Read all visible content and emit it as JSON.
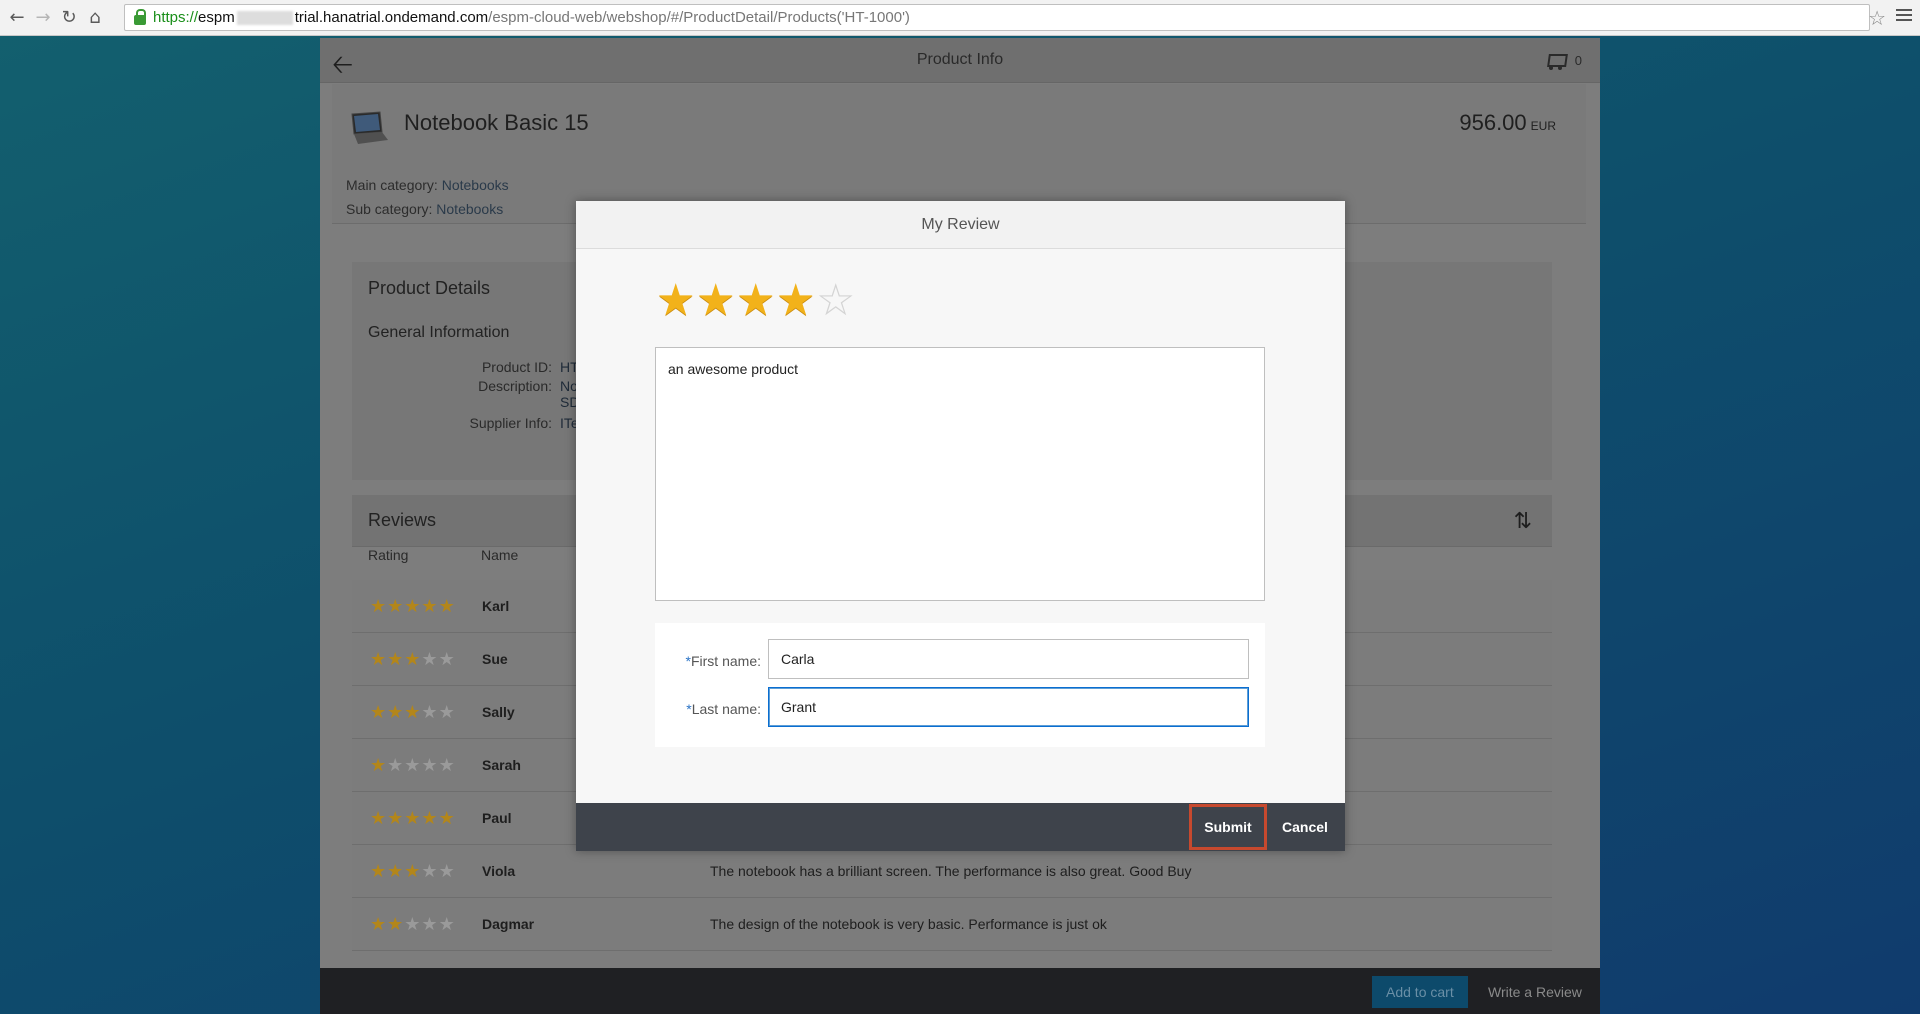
{
  "browser": {
    "url_https": "https://",
    "url_host_prefix": "espm",
    "url_host": "trial.hanatrial.ondemand.com",
    "url_path": "/espm-cloud-web/webshop/#/ProductDetail/Products('HT-1000')"
  },
  "app": {
    "title": "Product Info",
    "cart_count": "0",
    "product_name": "Notebook Basic 15",
    "price": "956.00",
    "currency": "EUR",
    "main_category_label": "Main category:",
    "main_category": "Notebooks",
    "sub_category_label": "Sub category:",
    "sub_category": "Notebooks",
    "details_title": "Product Details",
    "general_title": "General Information",
    "product_id_label": "Product ID:",
    "product_id_partial": "HT",
    "description_label": "Description:",
    "description_partial_1": "No",
    "description_partial_2": "SD",
    "supplier_label": "Supplier Info:",
    "supplier_partial": "ITe",
    "reviews_title": "Reviews",
    "col_rating": "Rating",
    "col_name": "Name",
    "reviews": [
      {
        "rating": 5,
        "name": "Karl",
        "text": ""
      },
      {
        "rating": 3,
        "name": "Sue",
        "text": ""
      },
      {
        "rating": 3,
        "name": "Sally",
        "text": ""
      },
      {
        "rating": 1,
        "name": "Sarah",
        "text": ""
      },
      {
        "rating": 5,
        "name": "Paul",
        "text": ""
      },
      {
        "rating": 3,
        "name": "Viola",
        "text": "The notebook has a brilliant screen. The performance is also great. Good Buy"
      },
      {
        "rating": 2,
        "name": "Dagmar",
        "text": "The design of the notebook is very basic. Performance is just ok"
      }
    ],
    "add_to_cart": "Add to cart",
    "write_review": "Write a Review"
  },
  "dialog": {
    "title": "My Review",
    "rating": 4,
    "rating_max": 5,
    "review_text": "an awesome product",
    "first_name_label": "First name:",
    "first_name": "Carla",
    "last_name_label": "Last name:",
    "last_name": "Grant",
    "required_mark": "*",
    "submit": "Submit",
    "cancel": "Cancel"
  },
  "colors": {
    "star_active": "#f2b21a",
    "accent": "#0a6ed1",
    "highlight": "#c7492e"
  }
}
